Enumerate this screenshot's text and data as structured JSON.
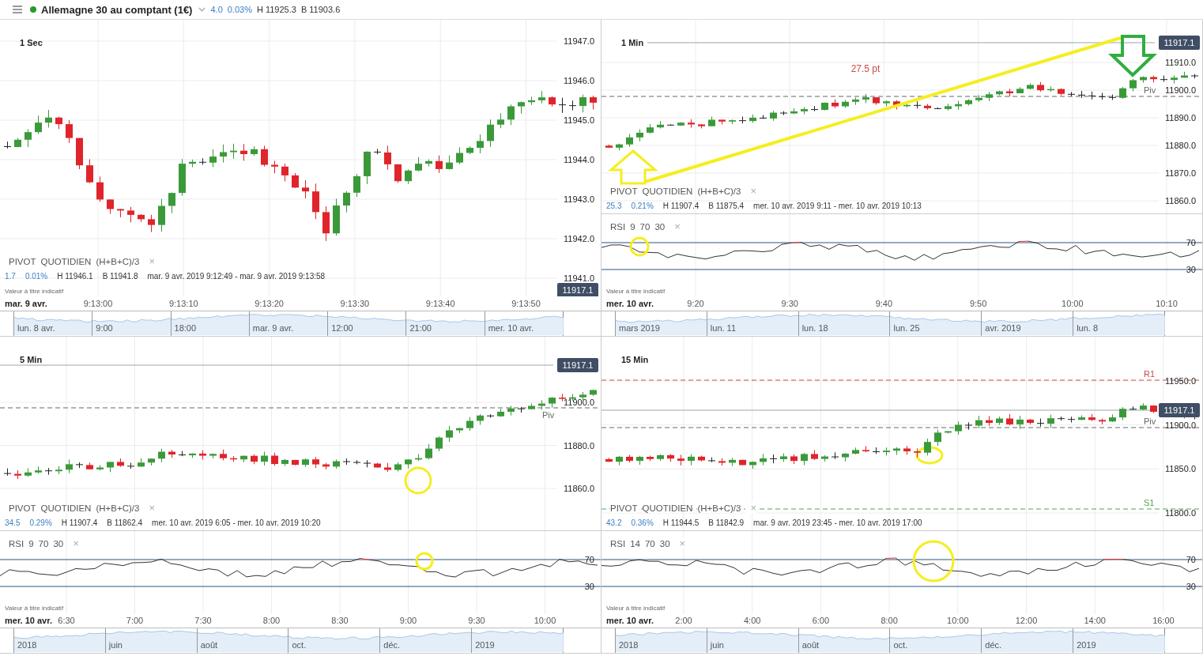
{
  "header": {
    "title": "Allemagne 30 au comptant (1€)",
    "change": "4.0",
    "percent": "0.03%",
    "high": "H 11925.3",
    "low": "B 11903.6"
  },
  "panels": [
    {
      "title": "1 Sec",
      "y_ticks": [
        "11947.0",
        "11946.0",
        "11945.0",
        "11944.0",
        "11943.0",
        "11942.0",
        "11941.0"
      ],
      "price_tag": "11917.1",
      "pivot": {
        "name": "PIVOT",
        "period": "QUOTIDIEN",
        "formula": "(H+B+C)/3",
        "close": "×"
      },
      "stats": {
        "change": "1.7",
        "percent": "0.01%",
        "high": "H 11946.1",
        "low": "B 11941.8",
        "range": "mar. 9 avr. 2019 9:12:49 - mar. 9 avr. 2019 9:13:58"
      },
      "note": "Valeur à titre indicatif",
      "x_axis": {
        "date": "mar. 9 avr.",
        "ticks": [
          "9:13:00",
          "9:13:10",
          "9:13:20",
          "9:13:30",
          "9:13:40",
          "9:13:50"
        ]
      },
      "navigator": [
        "lun. 8 avr.",
        "9:00",
        "18:00",
        "mar. 9 avr.",
        "12:00",
        "21:00",
        "mer. 10 avr."
      ]
    },
    {
      "title": "1 Min",
      "y_ticks": [
        "11910.0",
        "11900.0",
        "11890.0",
        "11880.0",
        "11870.0",
        "11860.0"
      ],
      "price_tag": "11917.1",
      "levels": [
        {
          "label": "Piv",
          "kind": "pivot"
        }
      ],
      "annotation_text": "27.5 pt",
      "pivot": {
        "name": "PIVOT",
        "period": "QUOTIDIEN",
        "formula": "(H+B+C)/3",
        "close": "×"
      },
      "stats": {
        "change": "25.3",
        "percent": "0.21%",
        "high": "H 11907.4",
        "low": "B 11875.4",
        "range": "mer. 10 avr. 2019 9:11 - mer. 10 avr. 2019 10:13"
      },
      "rsi": {
        "name": "RSI",
        "params": [
          "9",
          "70",
          "30"
        ],
        "close": "×",
        "levels": [
          "70",
          "30"
        ]
      },
      "note": "Valeur à titre indicatif",
      "x_axis": {
        "date": "mer. 10 avr.",
        "ticks": [
          "9:20",
          "9:30",
          "9:40",
          "9:50",
          "10:00",
          "10:10"
        ]
      },
      "navigator": [
        "mars 2019",
        "lun. 11",
        "lun. 18",
        "lun. 25",
        "avr. 2019",
        "lun. 8"
      ]
    },
    {
      "title": "5 Min",
      "y_ticks": [
        "11900.0",
        "11880.0",
        "11860.0"
      ],
      "price_tag": "11917.1",
      "levels": [
        {
          "label": "Piv",
          "kind": "pivot"
        }
      ],
      "pivot": {
        "name": "PIVOT",
        "period": "QUOTIDIEN",
        "formula": "(H+B+C)/3",
        "close": "×"
      },
      "stats": {
        "change": "34.5",
        "percent": "0.29%",
        "high": "H 11907.4",
        "low": "B 11862.4",
        "range": "mer. 10 avr. 2019 6:05 - mer. 10 avr. 2019 10:20"
      },
      "rsi": {
        "name": "RSI",
        "params": [
          "9",
          "70",
          "30"
        ],
        "close": "×",
        "levels": [
          "70",
          "30"
        ]
      },
      "note": "Valeur à titre indicatif",
      "x_axis": {
        "date": "mer. 10 avr.",
        "ticks": [
          "6:30",
          "7:00",
          "7:30",
          "8:00",
          "8:30",
          "9:00",
          "9:30",
          "10:00"
        ]
      },
      "navigator": [
        "2018",
        "juin",
        "août",
        "oct.",
        "déc.",
        "2019"
      ]
    },
    {
      "title": "15 Min",
      "y_ticks": [
        "11950.0",
        "11900.0",
        "11850.0",
        "11800.0"
      ],
      "price_tag": "11917.1",
      "levels": [
        {
          "label": "R1",
          "kind": "resistance"
        },
        {
          "label": "Piv",
          "kind": "pivot"
        },
        {
          "label": "S1",
          "kind": "support"
        }
      ],
      "pivot": {
        "name": "PIVOT",
        "period": "QUOTIDIEN",
        "formula": "(H+B+C)/3",
        "close": "×"
      },
      "stats": {
        "change": "43.2",
        "percent": "0.36%",
        "high": "H 11944.5",
        "low": "B 11842.9",
        "range": "mar. 9 avr. 2019 23:45 - mer. 10 avr. 2019 17:00"
      },
      "rsi": {
        "name": "RSI",
        "params": [
          "14",
          "70",
          "30"
        ],
        "close": "×",
        "levels": [
          "70",
          "30"
        ]
      },
      "note": "Valeur à titre indicatif",
      "x_axis": {
        "date": "mer. 10 avr.",
        "ticks": [
          "2:00",
          "4:00",
          "6:00",
          "8:00",
          "10:00",
          "12:00",
          "14:00",
          "16:00"
        ]
      },
      "navigator": [
        "2018",
        "juin",
        "août",
        "oct.",
        "déc.",
        "2019"
      ]
    }
  ]
}
